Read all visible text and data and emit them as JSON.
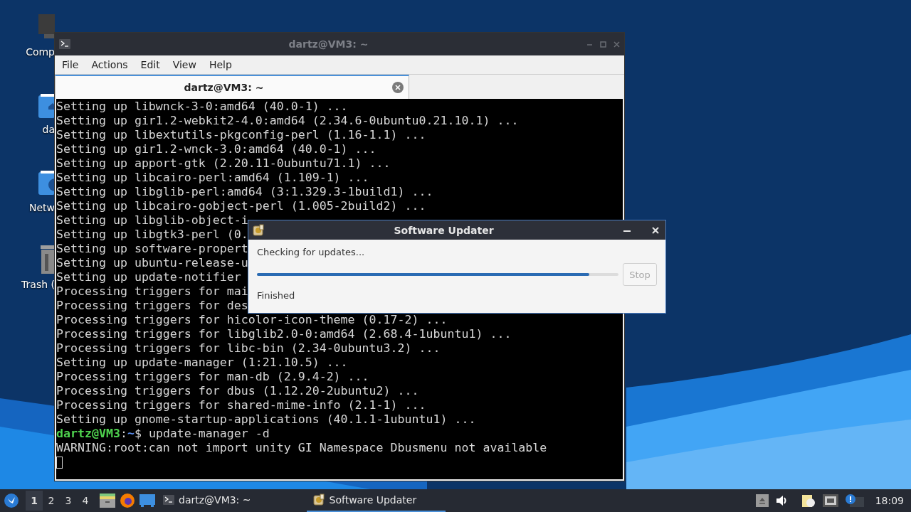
{
  "desktop_icons": [
    {
      "label": "Comp",
      "kind": "computer"
    },
    {
      "label": "da",
      "kind": "home"
    },
    {
      "label": "Netw",
      "kind": "network"
    },
    {
      "label": "Trash (",
      "kind": "trash"
    }
  ],
  "terminal": {
    "title": "dartz@VM3: ~",
    "menu": [
      "File",
      "Actions",
      "Edit",
      "View",
      "Help"
    ],
    "tabs": [
      {
        "label": "dartz@VM3: ~",
        "selected": true
      }
    ],
    "lines": [
      {
        "kind": "output",
        "text": "Setting up libwnck-3-0:amd64 (40.0-1) ..."
      },
      {
        "kind": "output",
        "text": "Setting up gir1.2-webkit2-4.0:amd64 (2.34.6-0ubuntu0.21.10.1) ..."
      },
      {
        "kind": "output",
        "text": "Setting up libextutils-pkgconfig-perl (1.16-1.1) ..."
      },
      {
        "kind": "output",
        "text": "Setting up gir1.2-wnck-3.0:amd64 (40.0-1) ..."
      },
      {
        "kind": "output",
        "text": "Setting up apport-gtk (2.20.11-0ubuntu71.1) ..."
      },
      {
        "kind": "output",
        "text": "Setting up libcairo-perl:amd64 (1.109-1) ..."
      },
      {
        "kind": "output",
        "text": "Setting up libglib-perl:amd64 (3:1.329.3-1build1) ..."
      },
      {
        "kind": "output",
        "text": "Setting up libcairo-gobject-perl (1.005-2build2) ..."
      },
      {
        "kind": "output",
        "text": "Setting up libglib-object-i"
      },
      {
        "kind": "output",
        "text": "Setting up libgtk3-perl (0."
      },
      {
        "kind": "output",
        "text": "Setting up software-propert"
      },
      {
        "kind": "output",
        "text": "Setting up ubuntu-release-u"
      },
      {
        "kind": "output",
        "text": "Setting up update-notifier"
      },
      {
        "kind": "output",
        "text": "Processing triggers for mai"
      },
      {
        "kind": "output",
        "text": "Processing triggers for des"
      },
      {
        "kind": "output",
        "text": "Processing triggers for hicolor-icon-theme (0.17-2) ..."
      },
      {
        "kind": "output",
        "text": "Processing triggers for libglib2.0-0:amd64 (2.68.4-1ubuntu1) ..."
      },
      {
        "kind": "output",
        "text": "Processing triggers for libc-bin (2.34-0ubuntu3.2) ..."
      },
      {
        "kind": "output",
        "text": "Setting up update-manager (1:21.10.5) ..."
      },
      {
        "kind": "output",
        "text": "Processing triggers for man-db (2.9.4-2) ..."
      },
      {
        "kind": "output",
        "text": "Processing triggers for dbus (1.12.20-2ubuntu2) ..."
      },
      {
        "kind": "output",
        "text": "Processing triggers for shared-mime-info (2.1-1) ..."
      },
      {
        "kind": "output",
        "text": "Setting up gnome-startup-applications (40.1.1-1ubuntu1) ..."
      },
      {
        "kind": "prompt",
        "user": "dartz@VM3",
        "sep": ":",
        "path": "~",
        "command": "$ update-manager -d"
      },
      {
        "kind": "output",
        "text": "WARNING:root:can not import unity GI Namespace Dbusmenu not available"
      }
    ]
  },
  "dialog": {
    "title": "Software Updater",
    "status": "Checking for updates...",
    "level": 0.92,
    "stop": {
      "label": "Stop",
      "disabled": true
    },
    "detail": "Finished"
  },
  "taskbar": {
    "workspaces": [
      {
        "label": "1",
        "selected": true
      },
      {
        "label": "2",
        "selected": false
      },
      {
        "label": "3",
        "selected": false
      },
      {
        "label": "4",
        "selected": false
      }
    ],
    "tasks": [
      {
        "label": "dartz@VM3: ~",
        "kind": "terminal",
        "selected": false
      },
      {
        "label": "Software Updater",
        "kind": "updater",
        "selected": true
      }
    ],
    "clock": "18:09"
  }
}
